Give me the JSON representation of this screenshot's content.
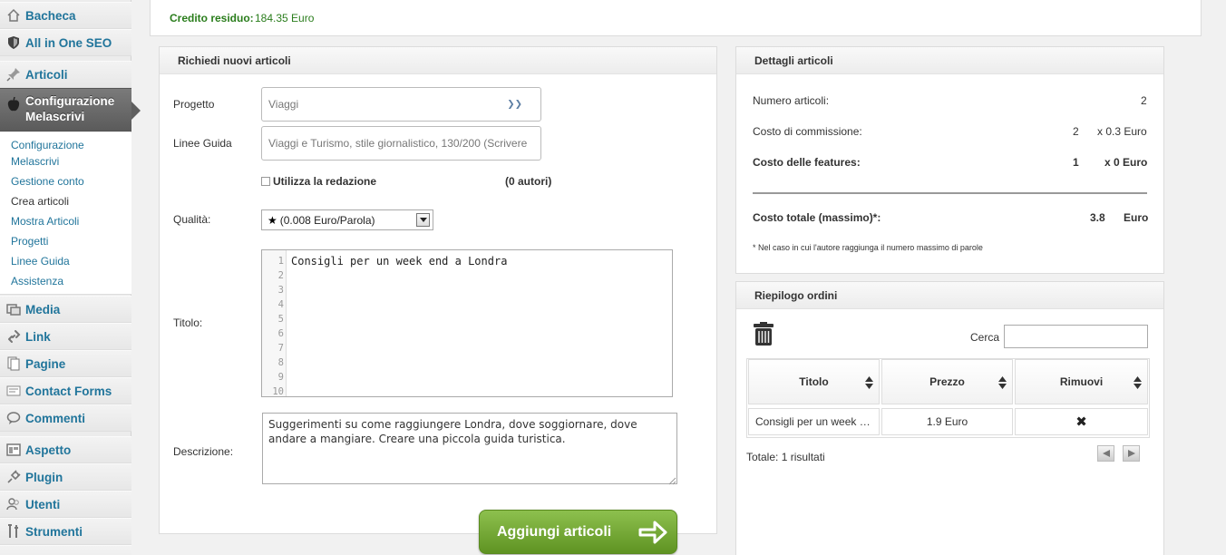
{
  "sidebar": {
    "top_items": [
      {
        "label": "Bacheca",
        "icon": "home-icon"
      },
      {
        "label": "All in One SEO",
        "icon": "shield-icon"
      },
      {
        "label": "Articoli",
        "icon": "pin-icon"
      }
    ],
    "active_item": {
      "label_line1": "Configurazione",
      "label_line2": "Melascrivi",
      "icon": "apple-icon"
    },
    "submenu": [
      {
        "label_line1": "Configurazione",
        "label_line2": "Melascrivi"
      },
      {
        "label": "Gestione conto"
      },
      {
        "label": "Crea articoli",
        "current": true
      },
      {
        "label": "Mostra Articoli"
      },
      {
        "label": "Progetti"
      },
      {
        "label": "Linee Guida"
      },
      {
        "label": "Assistenza"
      }
    ],
    "bottom_items": [
      {
        "label": "Media",
        "icon": "media-icon"
      },
      {
        "label": "Link",
        "icon": "link-icon"
      },
      {
        "label": "Pagine",
        "icon": "pages-icon"
      },
      {
        "label": "Contact Forms",
        "icon": "form-icon"
      },
      {
        "label": "Commenti",
        "icon": "comment-icon"
      },
      {
        "label": "Aspetto",
        "icon": "appearance-icon"
      },
      {
        "label": "Plugin",
        "icon": "plugin-icon"
      },
      {
        "label": "Utenti",
        "icon": "users-icon"
      },
      {
        "label": "Strumenti",
        "icon": "tools-icon"
      }
    ]
  },
  "credit": {
    "label": "Credito residuo:",
    "value": "184.35 Euro",
    "color": "#2a7d1c"
  },
  "request": {
    "title": "Richiedi nuovi articoli",
    "progetto_label": "Progetto",
    "progetto_value": "Viaggi",
    "linee_label": "Linee Guida",
    "linee_value": "Viaggi e Turismo, stile giornalistico, 130/200 (Scrivere",
    "redazione_label": "Utilizza la redazione",
    "autori": "(0 autori)",
    "qualita_label": "Qualità:",
    "qualita_value": "(0.008 Euro/Parola)",
    "qualita_stars": 1,
    "titolo_label": "Titolo:",
    "titolo_line1": "Consigli per un week end a Londra",
    "line_numbers": [
      "1",
      "2",
      "3",
      "4",
      "5",
      "6",
      "7",
      "8",
      "9",
      "10"
    ],
    "descrizione_label": "Descrizione:",
    "descrizione_value": "Suggerimenti su come raggiungere Londra, dove soggiornare, dove andare a mangiare. Creare una piccola guida turistica.",
    "submit_label": "Aggiungi articoli",
    "submit_color": "#6fa833"
  },
  "details": {
    "title": "Dettagli articoli",
    "numero_label": "Numero articoli:",
    "numero_value": "2",
    "commissione_label": "Costo di commissione:",
    "commissione_qty": "2",
    "commissione_unit": "x 0.3 Euro",
    "features_label": "Costo delle features:",
    "features_qty": "1",
    "features_unit": "x 0 Euro",
    "totale_label": "Costo totale (massimo)*:",
    "totale_value": "3.8",
    "totale_unit": "Euro",
    "note": "* Nel caso in cui l'autore raggiunga il numero massimo di parole"
  },
  "orders": {
    "title": "Riepilogo ordini",
    "search_label": "Cerca",
    "search_value": "",
    "columns": [
      "Titolo",
      "Prezzo",
      "Rimuovi"
    ],
    "rows": [
      {
        "titolo": "Consigli per un week end a Londra",
        "prezzo": "1.9 Euro",
        "rimuovi": "✖"
      }
    ],
    "total": "Totale: 1 risultati"
  }
}
